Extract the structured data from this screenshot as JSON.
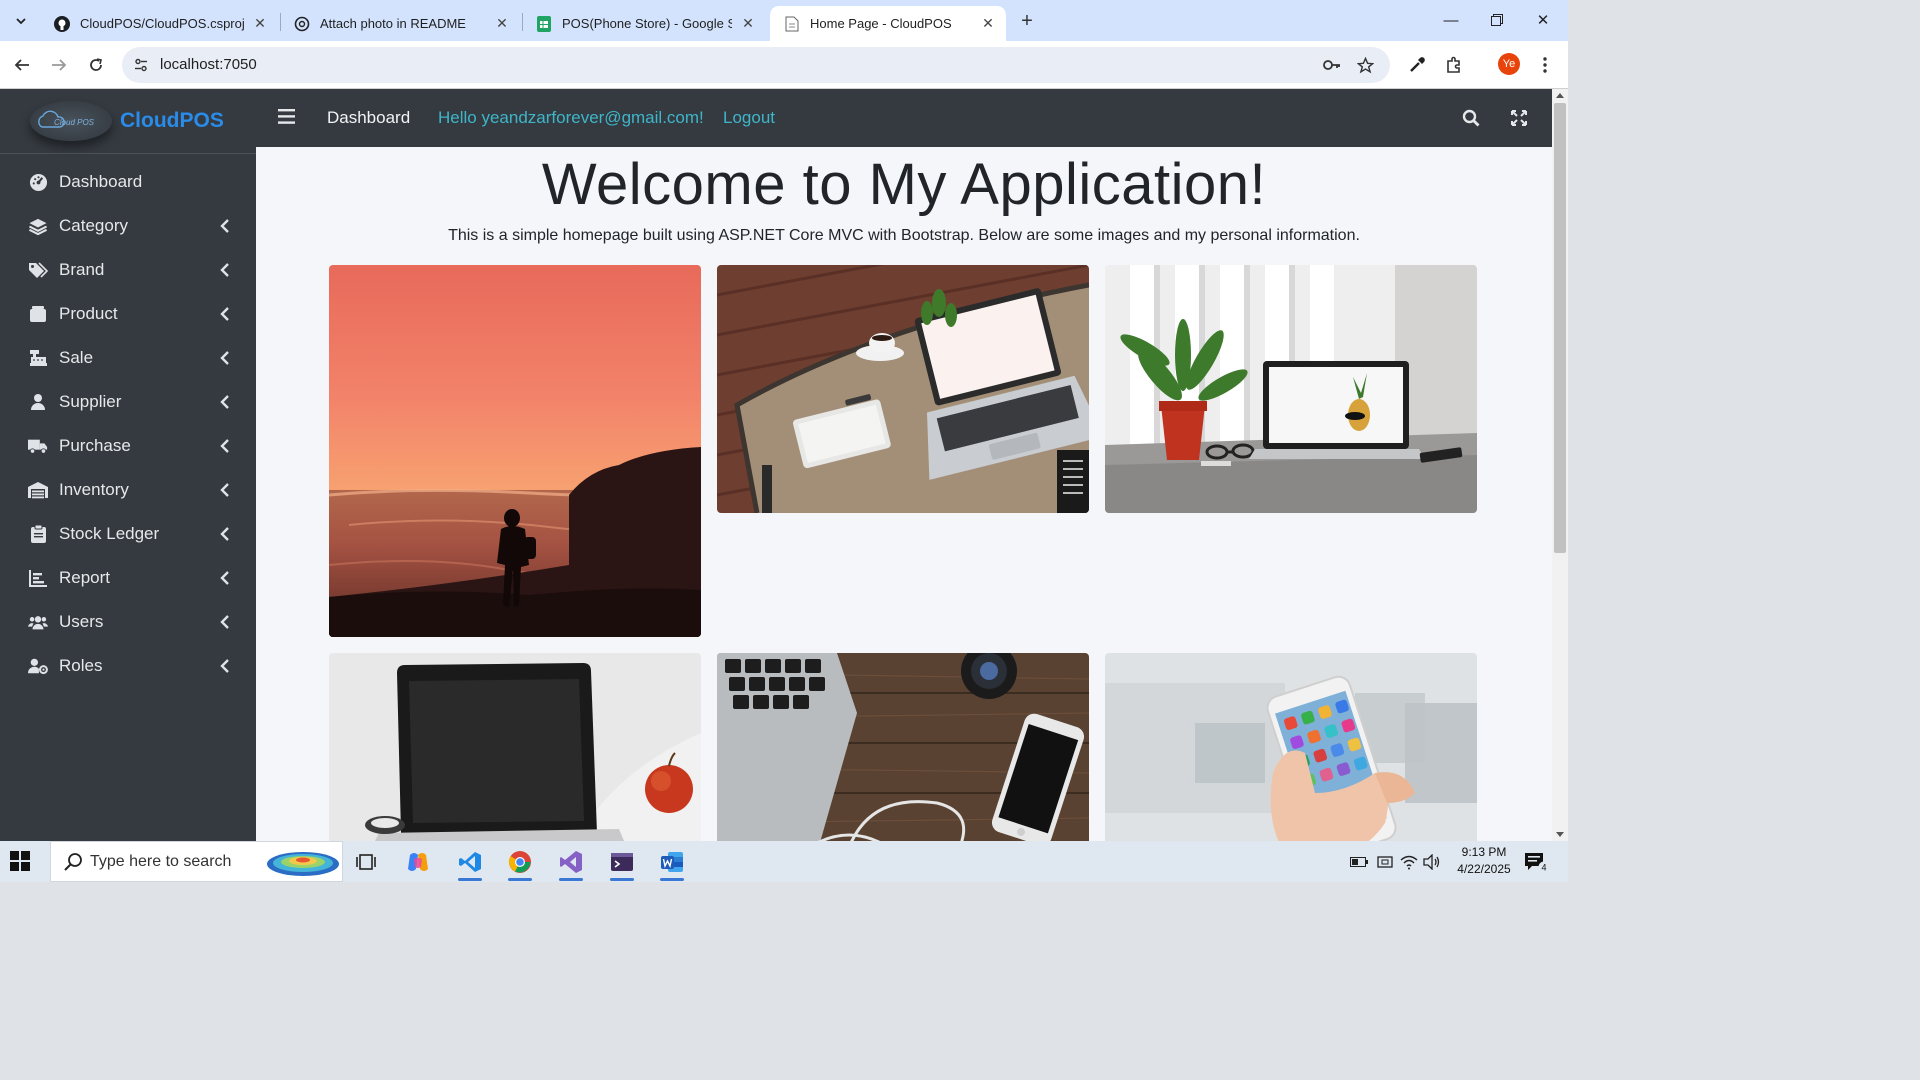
{
  "browser": {
    "tabs": [
      {
        "title": "CloudPOS/CloudPOS.csproj at r",
        "icon": "github-icon",
        "active": false
      },
      {
        "title": "Attach photo in README",
        "icon": "openai-icon",
        "active": false
      },
      {
        "title": "POS(Phone Store) - Google She",
        "icon": "google-sheets-icon",
        "active": false
      },
      {
        "title": "Home Page - CloudPOS",
        "icon": "page-icon",
        "active": true
      }
    ],
    "url": "localhost:7050",
    "profile_initials": "Ye"
  },
  "app": {
    "brand": "CloudPOS",
    "logo_text": "Cloud POS",
    "nav": {
      "dashboard": "Dashboard",
      "greeting": "Hello yeandzarforever@gmail.com!",
      "logout": "Logout"
    },
    "sidebar": [
      {
        "label": "Dashboard",
        "icon": "tachometer-icon",
        "has_submenu": false
      },
      {
        "label": "Category",
        "icon": "layers-icon",
        "has_submenu": true
      },
      {
        "label": "Brand",
        "icon": "tags-icon",
        "has_submenu": true
      },
      {
        "label": "Product",
        "icon": "product-box-icon",
        "has_submenu": true
      },
      {
        "label": "Sale",
        "icon": "cash-register-icon",
        "has_submenu": true
      },
      {
        "label": "Supplier",
        "icon": "user-icon",
        "has_submenu": true
      },
      {
        "label": "Purchase",
        "icon": "truck-icon",
        "has_submenu": true
      },
      {
        "label": "Inventory",
        "icon": "warehouse-icon",
        "has_submenu": true
      },
      {
        "label": "Stock Ledger",
        "icon": "clipboard-icon",
        "has_submenu": true
      },
      {
        "label": "Report",
        "icon": "chart-icon",
        "has_submenu": true
      },
      {
        "label": "Users",
        "icon": "users-icon",
        "has_submenu": true
      },
      {
        "label": "Roles",
        "icon": "user-cog-icon",
        "has_submenu": true
      }
    ],
    "main": {
      "title": "Welcome to My Application!",
      "subtitle": "This is a simple homepage built using ASP.NET Core MVC with Bootstrap. Below are some images and my personal information.",
      "images": [
        {
          "alt": "sunset-beach-photo"
        },
        {
          "alt": "laptop-on-wooden-desk-photo"
        },
        {
          "alt": "laptop-with-plant-photo"
        },
        {
          "alt": "laptop-with-apple-photo"
        },
        {
          "alt": "keyboard-phone-camera-photo"
        },
        {
          "alt": "hand-holding-phone-photo"
        }
      ]
    }
  },
  "taskbar": {
    "search_placeholder": "Type here to search",
    "time": "9:13 PM",
    "date": "4/22/2025",
    "notification_count": "4"
  },
  "colors": {
    "sidebar_bg": "#343a40",
    "brand_blue": "#2a8be8",
    "nav_link_teal": "#3fb5c9",
    "tab_strip": "#d3e3fd"
  }
}
